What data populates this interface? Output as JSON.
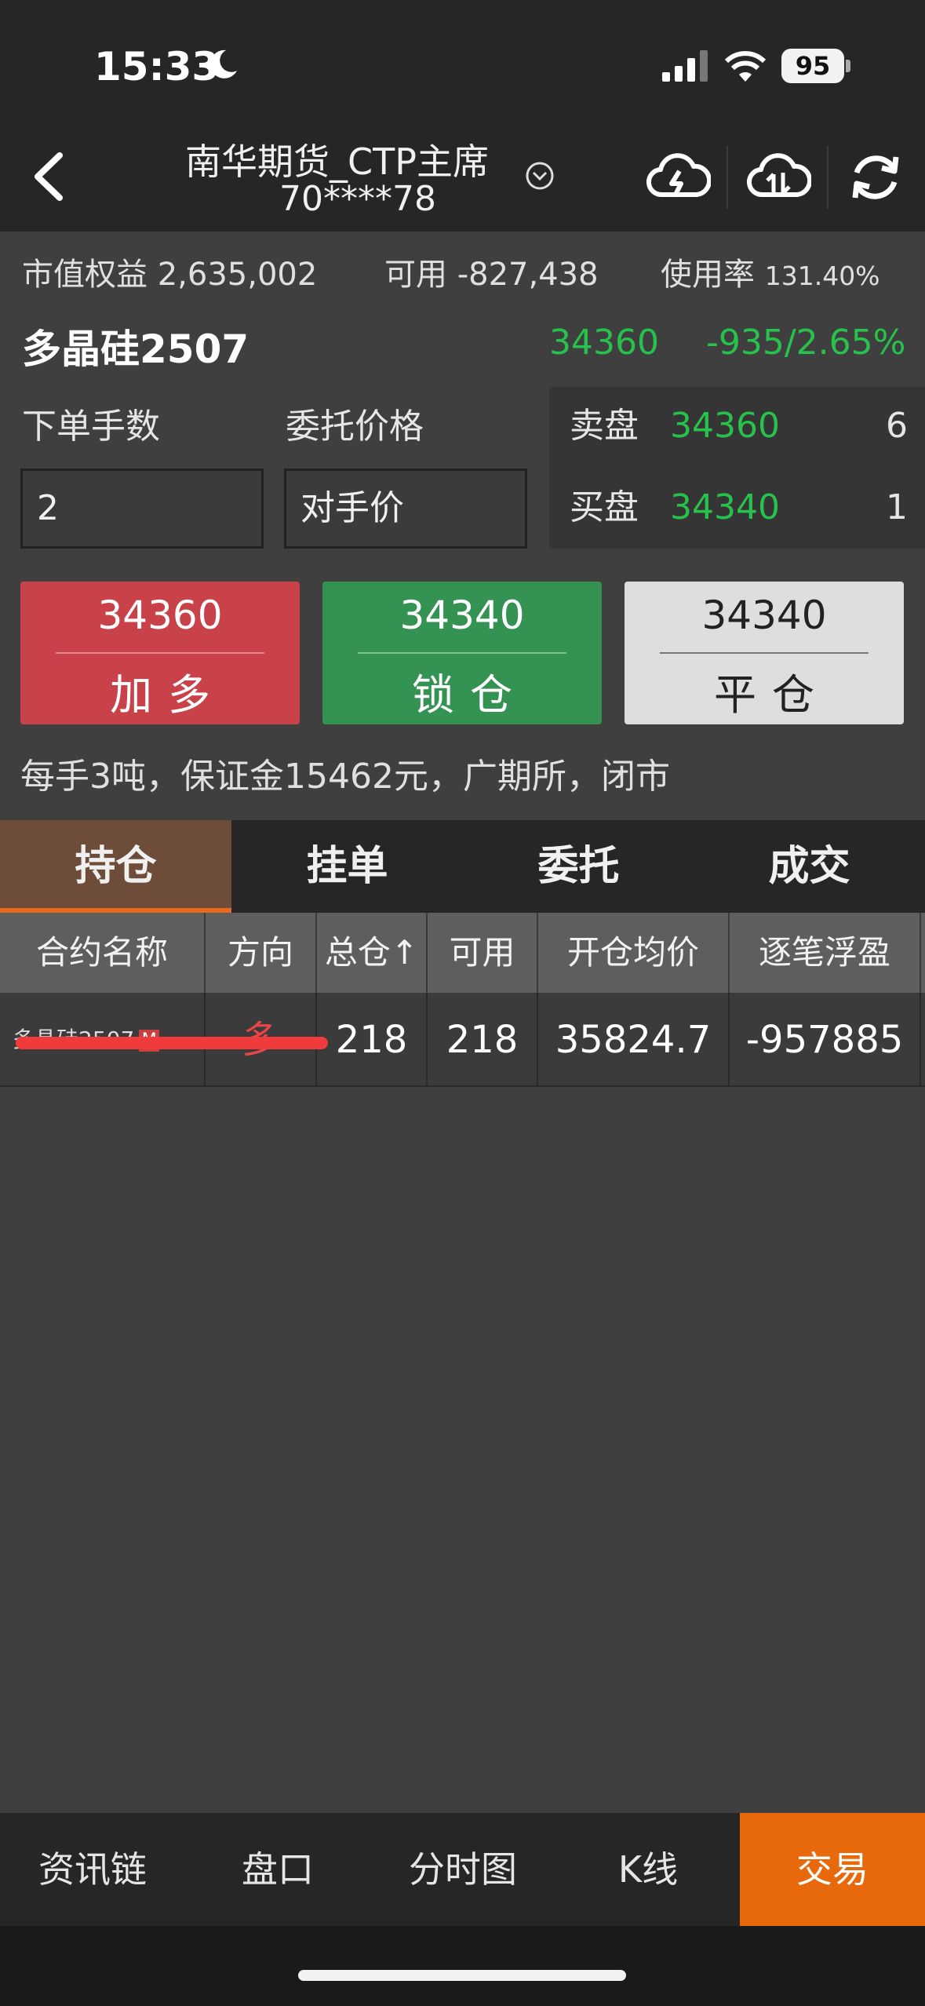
{
  "status": {
    "time": "15:33",
    "battery": "95"
  },
  "header": {
    "title": "南华期货_CTP主席",
    "account": "70****78"
  },
  "account": {
    "equity_label": "市值权益",
    "equity": "2,635,002",
    "available_label": "可用",
    "available": "-827,438",
    "usage_label": "使用率",
    "usage": "131.40%"
  },
  "quote": {
    "contract": "多晶硅2507",
    "last": "34360",
    "change": "-935/2.65%"
  },
  "order": {
    "qty_label": "下单手数",
    "qty": "2",
    "price_label": "委托价格",
    "price": "对手价"
  },
  "book": {
    "ask_label": "卖盘",
    "ask_price": "34360",
    "ask_qty": "6",
    "bid_label": "买盘",
    "bid_price": "34340",
    "bid_qty": "1"
  },
  "buttons": {
    "open_long_price": "34360",
    "open_long": "加多",
    "lock_price": "34340",
    "lock": "锁仓",
    "close_price": "34340",
    "close": "平仓"
  },
  "info": "每手3吨，保证金15462元，广期所，闭市",
  "tabs": [
    "持仓",
    "挂单",
    "委托",
    "成交"
  ],
  "table": {
    "headers": [
      "合约名称",
      "方向",
      "总仓↑",
      "可用",
      "开仓均价",
      "逐笔浮盈"
    ],
    "rows": [
      {
        "name": "多晶硅2507",
        "badge": "M",
        "direction": "多",
        "total": "218",
        "available": "218",
        "avg_price": "35824.7",
        "pnl": "-957885"
      }
    ]
  },
  "bottom_nav": [
    "资讯链",
    "盘口",
    "分时图",
    "K线",
    "交易"
  ],
  "colors": {
    "accent": "#e8690c",
    "up": "#c9424a",
    "down": "#27c24c",
    "lock": "#349252"
  }
}
